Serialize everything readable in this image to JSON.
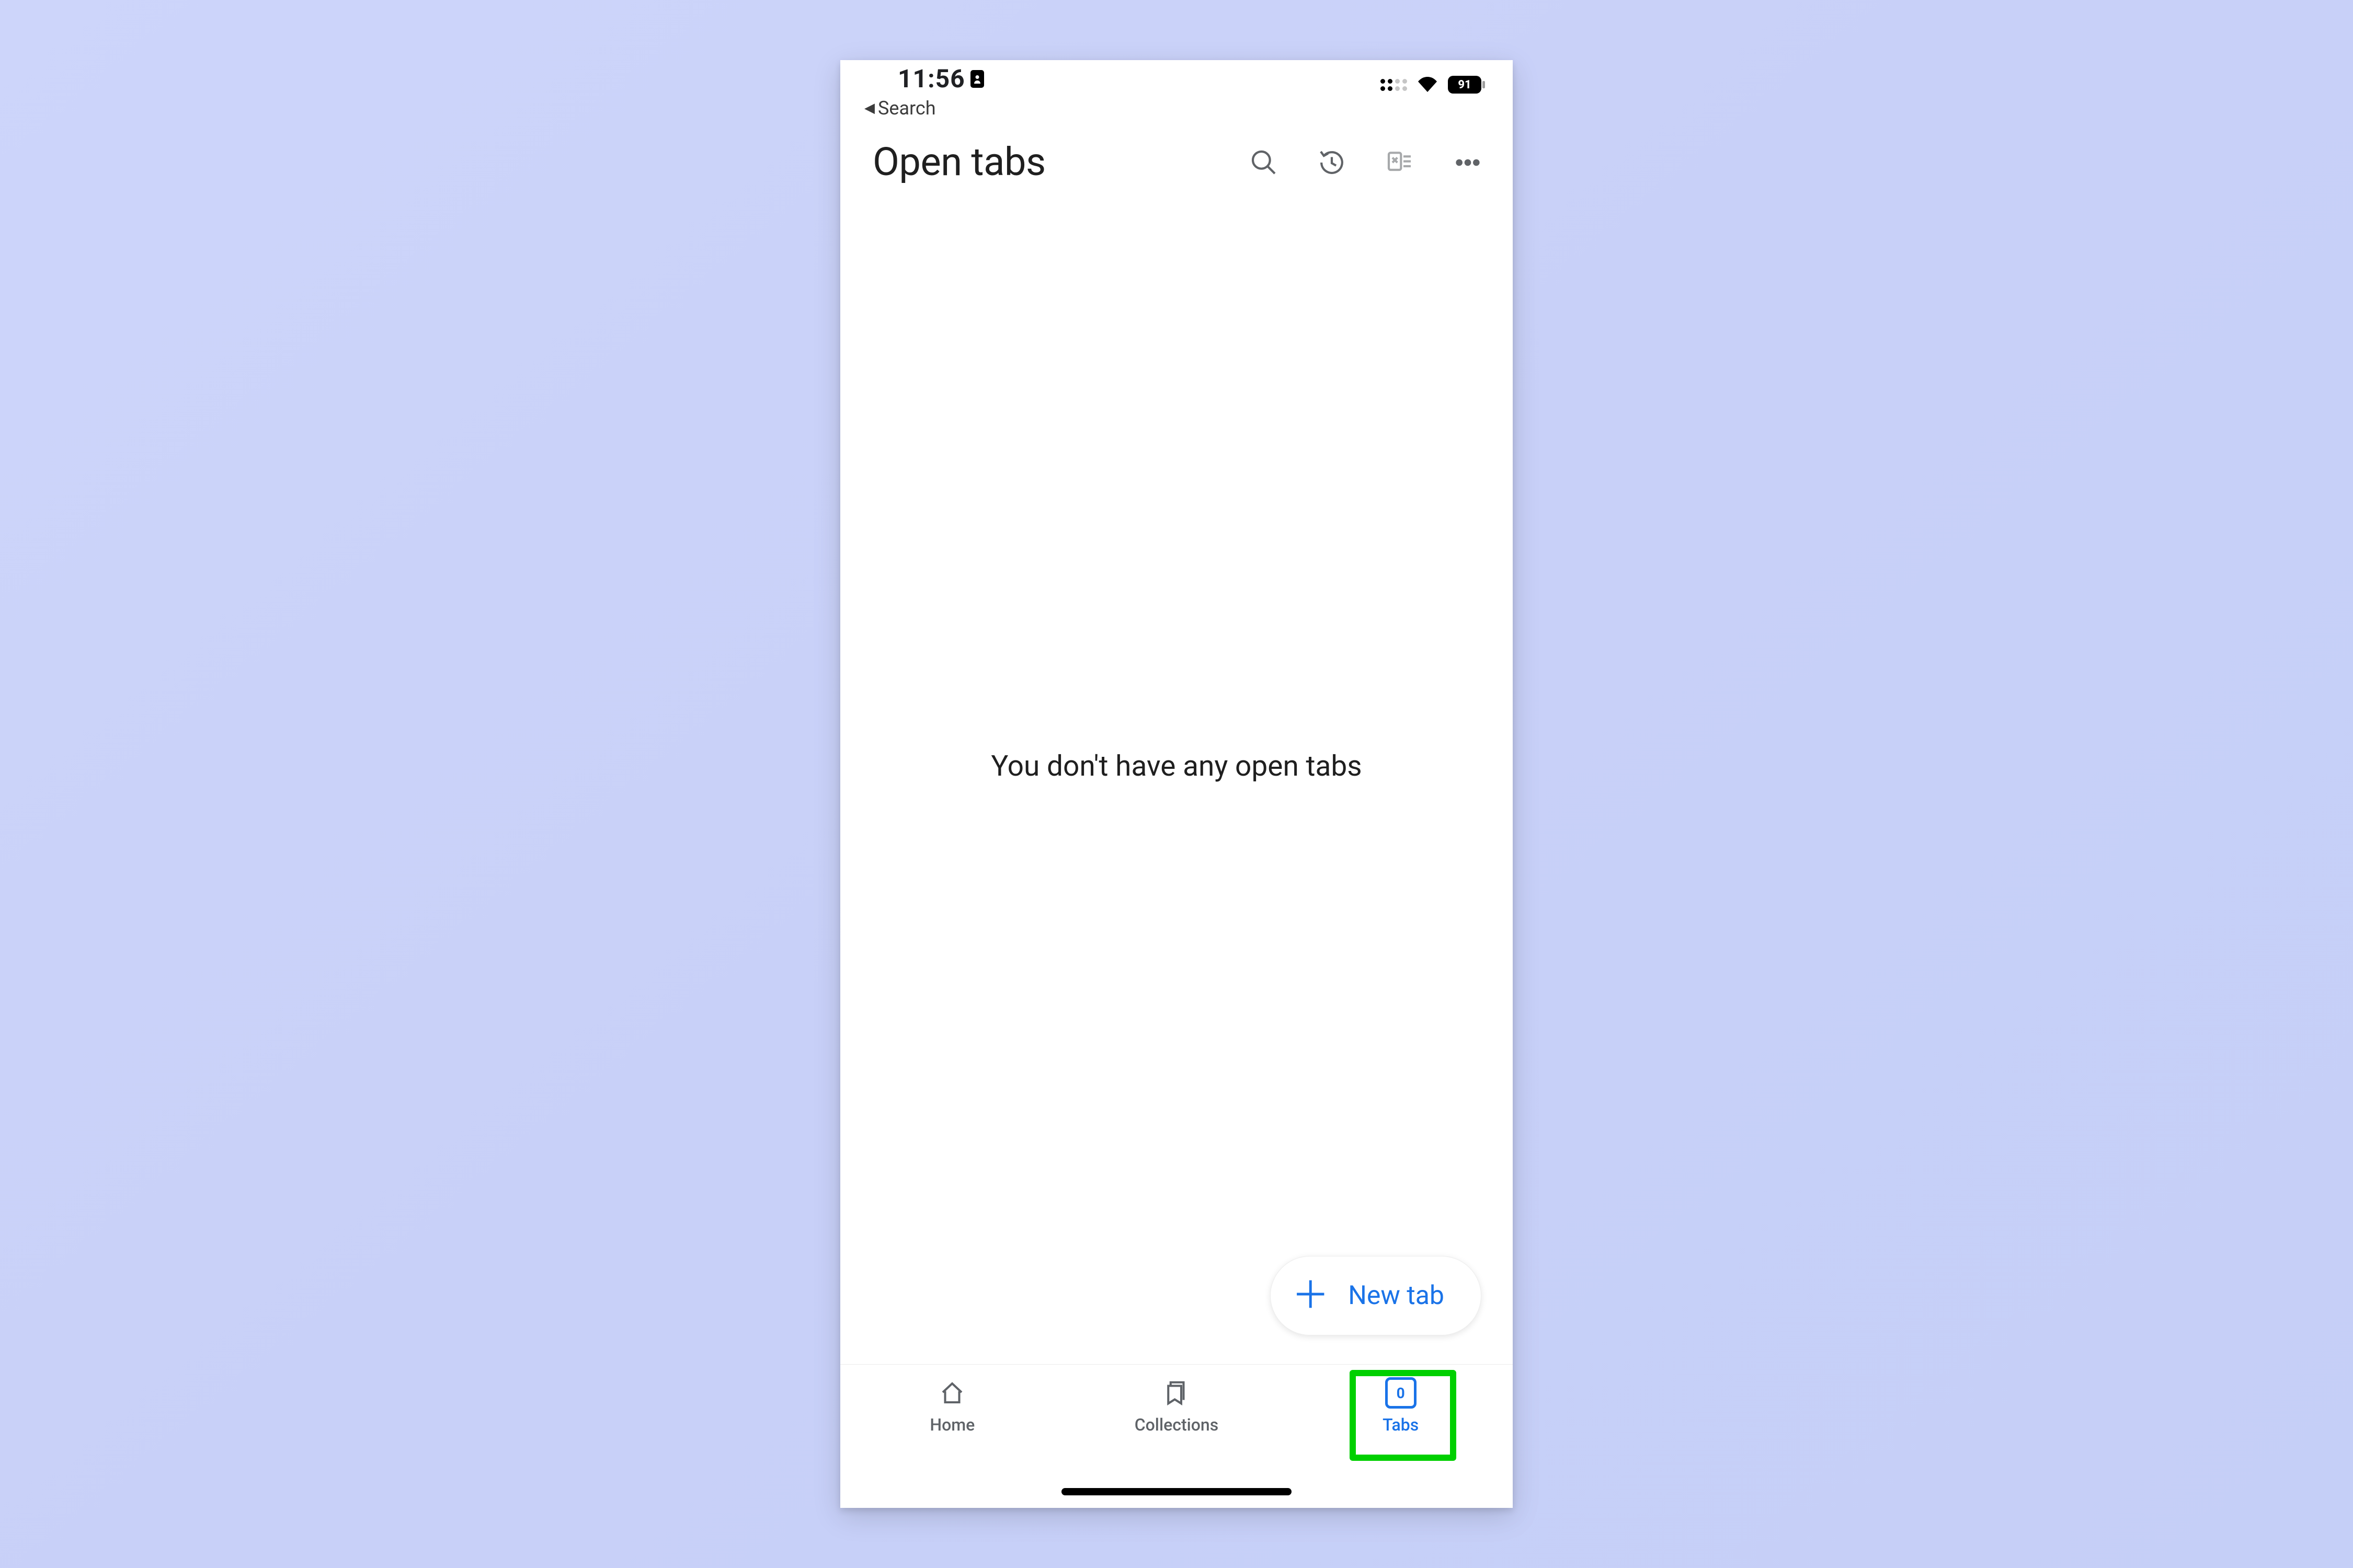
{
  "status": {
    "time": "11:56",
    "battery": "91"
  },
  "back": {
    "label": "Search"
  },
  "header": {
    "title": "Open tabs"
  },
  "empty": {
    "message": "You don't have any open tabs"
  },
  "fab": {
    "label": "New tab"
  },
  "nav": {
    "home": "Home",
    "collections": "Collections",
    "tabs": "Tabs",
    "tab_count": "0"
  }
}
